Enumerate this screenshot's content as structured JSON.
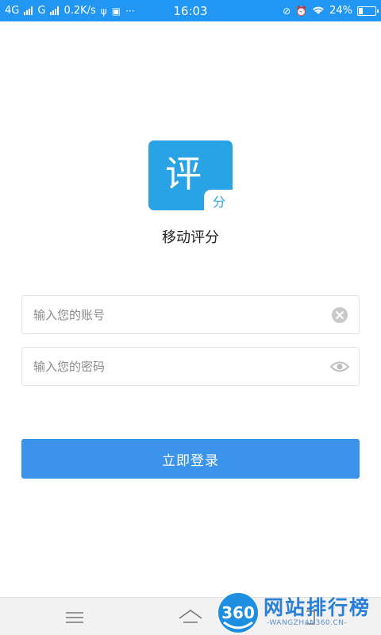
{
  "status_bar": {
    "network_1": "4G",
    "network_2": "G",
    "speed": "0.2K/s",
    "time": "16:03",
    "battery_percent": "24%",
    "battery_level": 0.24
  },
  "app": {
    "name": "移动评分"
  },
  "logo": {
    "main_char": "评",
    "sub_char": "分"
  },
  "login_form": {
    "account_placeholder": "输入您的账号",
    "account_value": "",
    "password_placeholder": "输入您的密码",
    "password_value": "",
    "login_label": "立即登录"
  },
  "watermark": {
    "number": "360",
    "title": "网站排行榜",
    "subtitle": "-WANGZHAN360.CN-"
  },
  "colors": {
    "status_bar": "#2196f3",
    "button": "#3b94ea",
    "logo": "#29a3e6"
  }
}
